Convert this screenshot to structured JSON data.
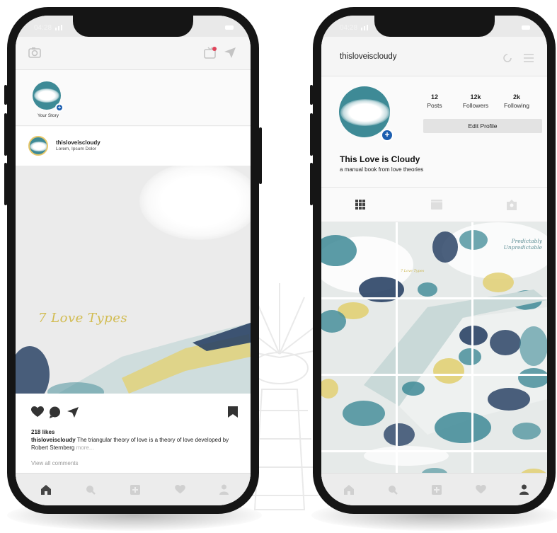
{
  "colors": {
    "accent_teal": "#3e8a96",
    "badge_blue": "#1d5fb0",
    "art_yellow": "#d2bc52",
    "art_navy": "#2b4466"
  },
  "feed": {
    "status_time": "04:28",
    "topbar": {
      "left_icon": "camera-icon",
      "right_icons": [
        "igtv-icon",
        "send-icon"
      ]
    },
    "story": {
      "label": "Your Story"
    },
    "post": {
      "username": "thisloveiscloudy",
      "subtitle": "Lorem, Ipsum Dolor",
      "art_text": "7 Love Types",
      "likes": "218 likes",
      "caption_user": "thisloveiscloudy",
      "caption_text": "The triangular theory of love is a theory of love developed by Robert Sternberg",
      "caption_more": "more...",
      "view_all": "View all comments"
    },
    "bottom_nav": [
      "home-icon",
      "search-icon",
      "add-icon",
      "heart-icon",
      "profile-icon"
    ]
  },
  "profile": {
    "status_time": "04:28",
    "username": "thisloveiscloudy",
    "header_icons": [
      "history-icon",
      "menu-icon"
    ],
    "stats": [
      {
        "value": "12",
        "label": "Posts"
      },
      {
        "value": "12k",
        "label": "Followers"
      },
      {
        "value": "2k",
        "label": "Following"
      }
    ],
    "edit_label": "Edit Profile",
    "display_name": "This Love is Cloudy",
    "bio": "a manual book from love theories",
    "tabs": [
      "grid-icon",
      "igtv-icon",
      "tagged-icon"
    ],
    "grid_text_top": "Predictably Unpredictable",
    "grid_text_small": "7 Love Types",
    "bottom_nav": [
      "home-icon",
      "search-icon",
      "add-icon",
      "heart-icon",
      "profile-icon"
    ]
  }
}
